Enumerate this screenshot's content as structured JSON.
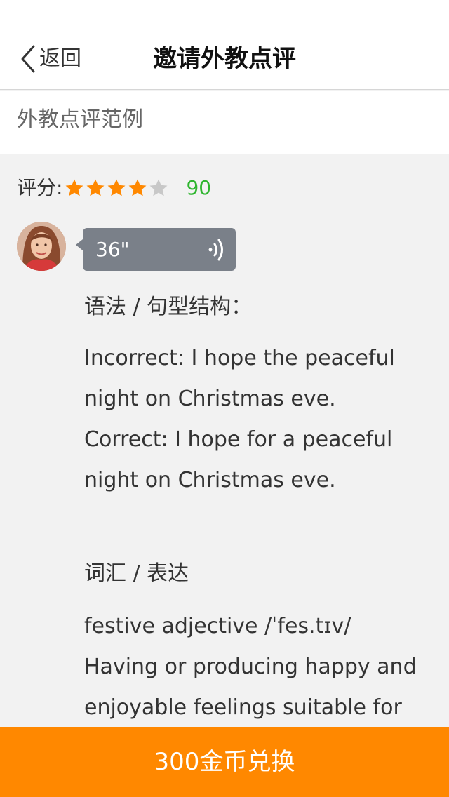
{
  "nav": {
    "back_label": "返回",
    "title": "邀请外教点评"
  },
  "section": {
    "label": "外教点评范例"
  },
  "rating": {
    "label": "评分:",
    "stars_filled": 4,
    "stars_total": 5,
    "score": "90"
  },
  "voice": {
    "duration": "36\""
  },
  "review": {
    "grammar_heading": "语法 / 句型结构：",
    "grammar_body": "Incorrect: I hope the peaceful\nnight on Christmas eve.\nCorrect: I hope for a peaceful\nnight on Christmas eve.",
    "vocab_heading": "词汇 / 表达",
    "vocab_body": "festive adjective /ˈfes.tɪv/\nHaving or producing happy and\nenjoyable feelings suitable for a"
  },
  "footer": {
    "redeem_label": "300金币兑换"
  },
  "colors": {
    "accent": "#ff8800",
    "star_filled": "#ff8800",
    "star_empty": "#c8c8c8",
    "score": "#2fb52f",
    "bubble": "#7a8089"
  },
  "icons": {
    "back": "chevron-left-icon",
    "voice": "sound-wave-icon",
    "star": "star-icon"
  }
}
